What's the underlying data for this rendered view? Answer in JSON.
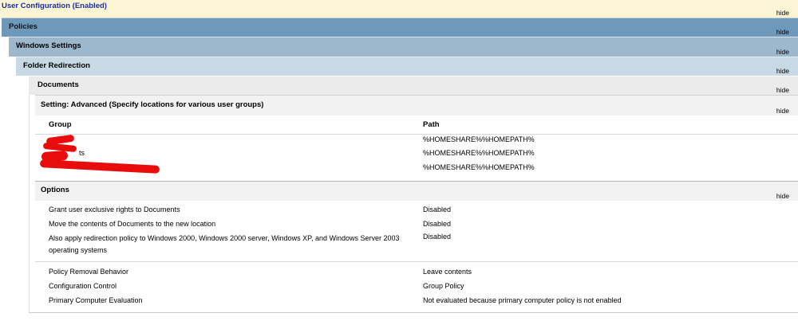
{
  "sections": {
    "user_config": {
      "title": "User Configuration (Enabled)",
      "hide": "hide"
    },
    "policies": {
      "title": "Policies",
      "hide": "hide"
    },
    "windows_settings": {
      "title": "Windows Settings",
      "hide": "hide"
    },
    "folder_redirection": {
      "title": "Folder Redirection",
      "hide": "hide"
    },
    "documents": {
      "title": "Documents",
      "hide": "hide"
    },
    "setting": {
      "title": "Setting: Advanced (Specify locations for various user groups)",
      "hide": "hide"
    },
    "options": {
      "title": "Options",
      "hide": "hide"
    }
  },
  "group_table": {
    "headers": [
      "Group",
      "Path"
    ],
    "rows": [
      {
        "group_visible": "",
        "path": "%HOMESHARE%%HOMEPATH%"
      },
      {
        "group_visible": "ts",
        "path": "%HOMESHARE%%HOMEPATH%"
      },
      {
        "group_visible": "",
        "path": "%HOMESHARE%%HOMEPATH%"
      }
    ]
  },
  "options_table": {
    "rows": [
      {
        "setting": "Grant user exclusive rights to Documents",
        "value": "Disabled"
      },
      {
        "setting": "Move the contents of Documents to the new location",
        "value": "Disabled"
      },
      {
        "setting": "Also apply redirection policy to Windows 2000, Windows 2000 server, Windows XP, and Windows Server 2003 operating systems",
        "value": "Disabled"
      },
      {
        "setting": "Policy Removal Behavior",
        "value": "Leave contents"
      },
      {
        "setting": "Configuration Control",
        "value": "Group Policy"
      },
      {
        "setting": "Primary Computer Evaluation",
        "value": "Not evaluated because primary computer policy is not enabled"
      }
    ]
  },
  "colors": {
    "user_config_bg": "#fbf5d6",
    "user_config_text": "#1b2fa0",
    "policies_bg": "#6f99ba",
    "windows_settings_bg": "#9db8cc",
    "folder_redirection_bg": "#c6d9e5",
    "documents_bg": "#ebebeb",
    "redaction": "#e80c0c"
  }
}
